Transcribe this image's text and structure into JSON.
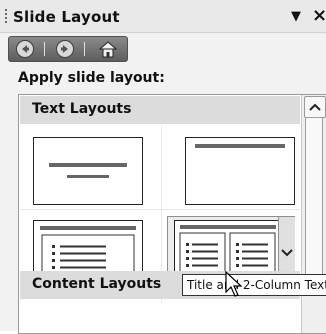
{
  "panel": {
    "title": "Slide Layout",
    "menu_glyph": "▼",
    "close_glyph": "×"
  },
  "toolbar": {
    "back_icon": "back-arrow-icon",
    "forward_icon": "forward-arrow-icon",
    "home_icon": "home-icon"
  },
  "apply_label": "Apply slide layout:",
  "sections": [
    {
      "label": "Text Layouts"
    },
    {
      "label": "Content Layouts"
    }
  ],
  "layouts": [
    {
      "name": "title-slide"
    },
    {
      "name": "title-only"
    },
    {
      "name": "title-and-text"
    },
    {
      "name": "title-and-2-column-text"
    }
  ],
  "tooltip": "Title and 2-Column Text",
  "colors": {
    "header": "#dcdcdc",
    "selection": "#ececec",
    "pane_bg": "#ffffff"
  }
}
